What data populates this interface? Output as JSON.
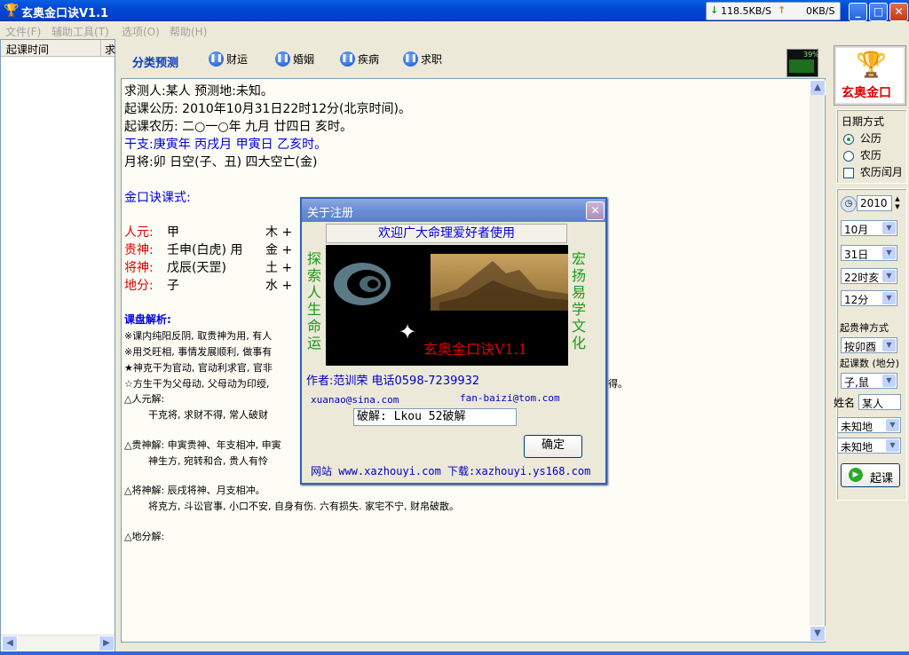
{
  "window": {
    "title": "玄奥金口诀V1.1",
    "net_down": "118.5KB/S",
    "net_up": "0KB/S"
  },
  "menu": [
    "文件(F)",
    "辅助工具(T)",
    "选项(O)",
    "帮助(H)"
  ],
  "list": {
    "col_time": "起课时间",
    "col_2": "求"
  },
  "toolbar": {
    "category": "分类预测",
    "items": [
      "财运",
      "婚姻",
      "疾病",
      "求职"
    ],
    "cpu": "39%"
  },
  "main": {
    "l1": "求测人:某人    预测地:未知。",
    "l2": "起课公历: 2010年10月31日22时12分(北京时间)。",
    "l3": "起课农历: 二○一○年 九月 廿四日 亥时。",
    "l4": "干支:庚寅年  丙戌月  甲寅日  乙亥时。",
    "l5": "月将:卯  日空(子、丑)  四大空亡(金)",
    "l6": "金口诀课式:",
    "rows": [
      {
        "label": "人元:",
        "value": "甲",
        "elem": "木 +"
      },
      {
        "label": "贵神:",
        "value": "壬申(白虎) 用",
        "elem": "金 +"
      },
      {
        "label": "将神:",
        "value": "戊辰(天罡)",
        "elem": "土 +"
      },
      {
        "label": "地分:",
        "value": "子",
        "elem": "水 +"
      }
    ],
    "analysis_title": "课盘解析:",
    "a1": "※课内纯阳反阴, 取贵神为用, 有人",
    "a2": "※用爻旺相, 事情发展顺利, 做事有",
    "a3": "★神克干为官动, 官动利求官, 官非",
    "a4": "☆方生干为父母动, 父母动为印绶,",
    "a4b": "得。",
    "b1": "△人元解:",
    "b2": "干克将, 求财不得, 常人破财",
    "b3": "△贵神解: 申寅贵神、年支相冲, 申寅",
    "b4": "神生方, 宛转和合, 贵人有怜",
    "b5": "△将神解: 辰戌将神、月支相冲。",
    "b6": "将克方, 斗讼官事, 小口不安, 自身有伤. 六有损失. 家宅不宁, 财帛破散。",
    "b7": "△地分解:"
  },
  "right": {
    "logo_text": "玄奥金口",
    "date_mode_label": "日期方式",
    "opt_gongli": "公历",
    "opt_nongli": "农历",
    "opt_runyue": "农历闰月",
    "year": "2010",
    "month": "10月",
    "day": "31日",
    "hour": "22时亥",
    "minute": "12分",
    "guishen_label": "起贵神方式",
    "guishen_value": "按卯酉",
    "kecount_label": "起课数 (地分)",
    "kecount_value": "子,鼠",
    "name_label": "姓名",
    "name_value": "某人",
    "place1": "未知地",
    "place2": "未知地",
    "start_button": "起课"
  },
  "dialog": {
    "title": "关于注册",
    "welcome": "欢迎广大命理爱好者使用",
    "banner_title": "玄奥金口诀V1.1",
    "left_vertical": "探索人生命运",
    "right_vertical": "宏扬易学文化",
    "author": "作者:范训荣  电话0598-7239932",
    "email1": "xuanao@sina.com",
    "email2": "fan-baizi@tom.com",
    "crack": "破解: Lkou 52破解",
    "ok": "确定",
    "site": "网站 www.xazhouyi.com  下载:xazhouyi.ys168.com"
  }
}
